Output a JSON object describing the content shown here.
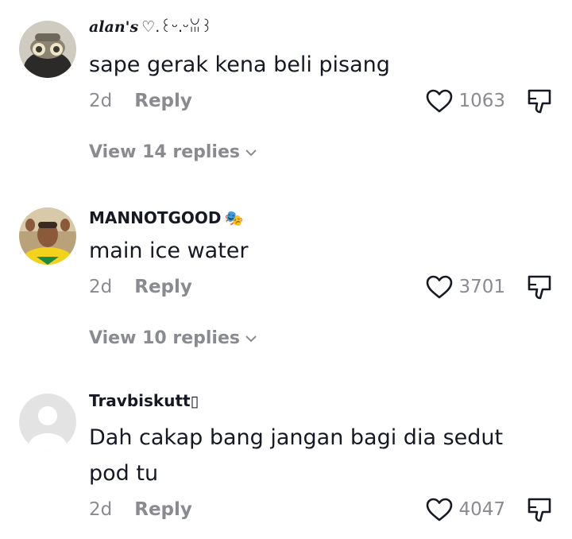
{
  "comments": [
    {
      "username": "alan's",
      "username_deco": "♡.꒰ᵕ.ᵕꈍ꒱",
      "text": "sape gerak kena beli pisang",
      "date": "2d",
      "reply_label": "Reply",
      "likes": "1063",
      "view_replies": "View 14 replies"
    },
    {
      "username": "MANNOTGOOD",
      "username_deco": "🎭",
      "text": "main ice water",
      "date": "2d",
      "reply_label": "Reply",
      "likes": "3701",
      "view_replies": "View 10 replies"
    },
    {
      "username": "Travbiskutt",
      "username_deco": "▯",
      "text": "Dah cakap bang jangan bagi dia sedut pod tu",
      "date": "2d",
      "reply_label": "Reply",
      "likes": "4047"
    }
  ],
  "colors": {
    "primary_text": "#161823",
    "secondary_text": "#8a8b91",
    "background": "#ffffff"
  },
  "icons": {
    "like": "heart-outline-icon",
    "dislike": "thumbs-down-icon",
    "expand": "chevron-down-icon"
  }
}
